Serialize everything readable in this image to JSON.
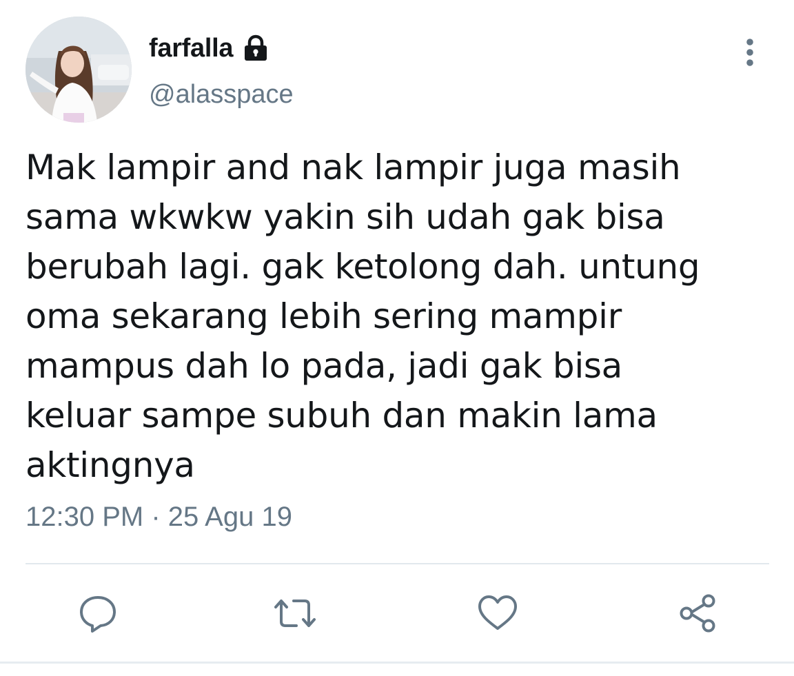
{
  "tweet": {
    "author": {
      "display_name": "farfalla",
      "handle": "@alasspace",
      "protected_icon": "lock-icon",
      "avatar": "profile-photo"
    },
    "text_lines": [
      "Mak lampir and nak lampir juga masih",
      "sama wkwkw yakin sih udah gak bisa",
      "berubah lagi. gak ketolong dah. untung",
      "oma sekarang lebih sering mampir",
      "mampus dah lo pada, jadi gak bisa",
      "keluar sampe subuh dan makin lama",
      "aktingnya"
    ],
    "timestamp": "12:30 PM · 25 Agu 19",
    "menu_icon": "more-vertical-icon",
    "actions": [
      {
        "name": "reply",
        "icon": "reply-icon"
      },
      {
        "name": "retweet",
        "icon": "retweet-icon"
      },
      {
        "name": "like",
        "icon": "heart-icon"
      },
      {
        "name": "share",
        "icon": "share-icon"
      }
    ]
  },
  "colors": {
    "text": "#14171a",
    "secondary": "#657786",
    "divider": "#e1e8ed",
    "background": "#ffffff"
  }
}
